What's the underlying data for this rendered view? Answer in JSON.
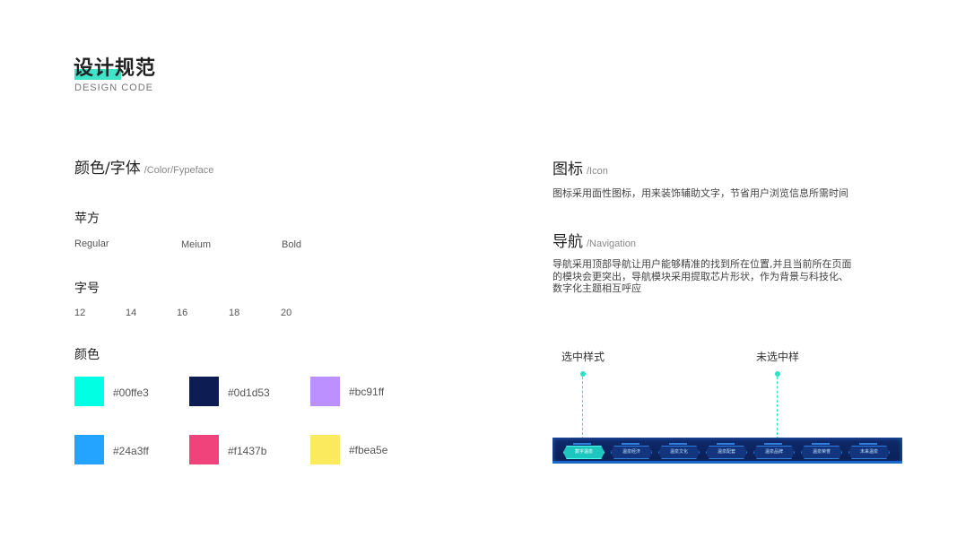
{
  "header": {
    "title": "设计规范",
    "subtitle": "DESIGN CODE"
  },
  "color_font": {
    "heading": "颜色/字体",
    "heading_sub": "/Color/Fypeface",
    "font_title": "苹方",
    "weights": [
      "Regular",
      "Meium",
      "Bold"
    ],
    "size_title": "字号",
    "sizes": [
      "12",
      "14",
      "16",
      "18",
      "20"
    ],
    "color_title": "颜色",
    "colors": [
      {
        "hex": "#00ffe3",
        "label": "#00ffe3"
      },
      {
        "hex": "#0d1d53",
        "label": "#0d1d53"
      },
      {
        "hex": "#bc91ff",
        "label": "#bc91ff"
      },
      {
        "hex": "#24a3ff",
        "label": "#24a3ff"
      },
      {
        "hex": "#f1437b",
        "label": "#f1437b"
      },
      {
        "hex": "#fbea5e",
        "label": "#fbea5e"
      }
    ]
  },
  "icon": {
    "heading": "图标",
    "heading_sub": "/Icon",
    "desc": "图标采用面性图标，用来装饰辅助文字，节省用户浏览信息所需时间"
  },
  "navigation": {
    "heading": "导航",
    "heading_sub": "/Navigation",
    "desc_line1": "导航采用顶部导航让用户能够精准的找到所在位置,并且当前所在页面",
    "desc_line2": "的模块会更突出，导航模块采用提取芯片形状，作为背景与科技化、",
    "desc_line3": "数字化主题相互呼应",
    "selected_label": "选中样式",
    "unselected_label": "未选中样",
    "items": [
      "数字温泉",
      "温泉经济",
      "温泉文化",
      "温泉配套",
      "温泉品牌",
      "温泉荣誉",
      "未来温泉"
    ]
  }
}
